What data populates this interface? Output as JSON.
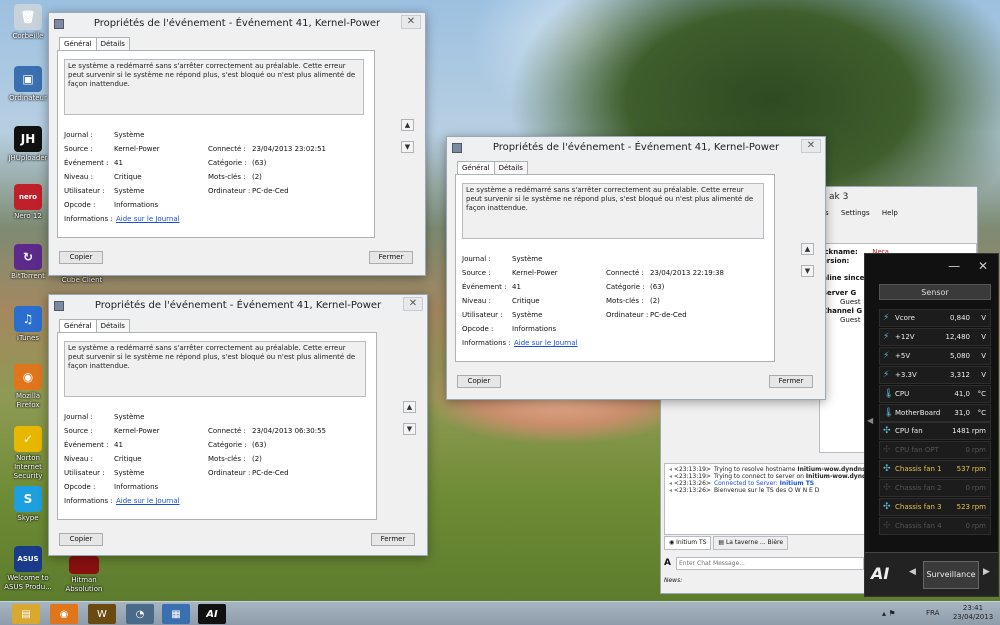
{
  "desktop_icons": [
    {
      "label": "Corbeille",
      "glyph": "🗑",
      "color": "#c8d2dc"
    },
    {
      "label": "Ordinateur",
      "glyph": "▣",
      "color": "#3a6fb0"
    },
    {
      "label": "JHUploader",
      "glyph": "JH",
      "color": "#111111"
    },
    {
      "label": "Nero 12",
      "glyph": "nero",
      "color": "#c0202a"
    },
    {
      "label": "BitTorrent",
      "glyph": "↻",
      "color": "#5b2a8a"
    },
    {
      "label": "iTunes",
      "glyph": "♫",
      "color": "#2a6fd0"
    },
    {
      "label": "Mozilla Firefox",
      "glyph": "◉",
      "color": "#e0751c"
    },
    {
      "label": "Norton Internet Security",
      "glyph": "✓",
      "color": "#e8b800"
    },
    {
      "label": "Skype",
      "glyph": "S",
      "color": "#1ea0e0"
    },
    {
      "label": "Welcome to ASUS Produ...",
      "glyph": "ASUS",
      "color": "#1a3a8a"
    }
  ],
  "extra_icons": [
    {
      "label": "Cube Client"
    },
    {
      "label": "Hitman Absolution"
    }
  ],
  "event_windows": [
    {
      "title": "Propriétés de l'événement - Événement 41, Kernel-Power",
      "tab_general": "Général",
      "tab_details": "Détails",
      "description": "Le système a redémarré sans s'arrêter correctement au préalable. Cette erreur peut survenir si le système ne répond plus, s'est bloqué ou n'est plus alimenté de façon inattendue.",
      "journal_label": "Journal :",
      "journal": "Système",
      "source_label": "Source :",
      "source": "Kernel-Power",
      "event_label": "Événement :",
      "event": "41",
      "level_label": "Niveau :",
      "level": "Critique",
      "user_label": "Utilisateur :",
      "user": "Système",
      "opcode_label": "Opcode :",
      "opcode": "Informations",
      "info_label": "Informations :",
      "info_link": "Aide sur le Journal",
      "logged_label": "Connecté :",
      "logged": "23/04/2013 23:02:51",
      "category_label": "Catégorie :",
      "category": "(63)",
      "keywords_label": "Mots-clés :",
      "keywords": "(2)",
      "computer_label": "Ordinateur :",
      "computer": "PC-de-Ced",
      "copy": "Copier",
      "close": "Fermer"
    },
    {
      "title": "Propriétés de l'événement - Événement 41, Kernel-Power",
      "tab_general": "Général",
      "tab_details": "Détails",
      "description": "Le système a redémarré sans s'arrêter correctement au préalable. Cette erreur peut survenir si le système ne répond plus, s'est bloqué ou n'est plus alimenté de façon inattendue.",
      "journal_label": "Journal :",
      "journal": "Système",
      "source_label": "Source :",
      "source": "Kernel-Power",
      "event_label": "Événement :",
      "event": "41",
      "level_label": "Niveau :",
      "level": "Critique",
      "user_label": "Utilisateur :",
      "user": "Système",
      "opcode_label": "Opcode :",
      "opcode": "Informations",
      "info_label": "Informations :",
      "info_link": "Aide sur le Journal",
      "logged_label": "Connecté :",
      "logged": "23/04/2013 06:30:55",
      "category_label": "Catégorie :",
      "category": "(63)",
      "keywords_label": "Mots-clés :",
      "keywords": "(2)",
      "computer_label": "Ordinateur :",
      "computer": "PC-de-Ced",
      "copy": "Copier",
      "close": "Fermer"
    },
    {
      "title": "Propriétés de l'événement - Événement 41, Kernel-Power",
      "tab_general": "Général",
      "tab_details": "Détails",
      "description": "Le système a redémarré sans s'arrêter correctement au préalable. Cette erreur peut survenir si le système ne répond plus, s'est bloqué ou n'est plus alimenté de façon inattendue.",
      "journal_label": "Journal :",
      "journal": "Système",
      "source_label": "Source :",
      "source": "Kernel-Power",
      "event_label": "Événement :",
      "event": "41",
      "level_label": "Niveau :",
      "level": "Critique",
      "user_label": "Utilisateur :",
      "user": "Système",
      "opcode_label": "Opcode :",
      "opcode": "Informations",
      "info_label": "Informations :",
      "info_link": "Aide sur le Journal",
      "logged_label": "Connecté :",
      "logged": "23/04/2013 22:19:38",
      "category_label": "Catégorie :",
      "category": "(63)",
      "keywords_label": "Mots-clés :",
      "keywords": "(2)",
      "computer_label": "Ordinateur :",
      "computer": "PC-de-Ced",
      "copy": "Copier",
      "close": "Fermer"
    }
  ],
  "teamspeak": {
    "title": "ak 3",
    "menu": [
      "ks",
      "Settings",
      "Help"
    ],
    "info_nickname": "ickname:",
    "info_version": "ersion:",
    "nickname_value": "Nera",
    "online_since": "nline since",
    "server_group": "Server G",
    "server_group_value": "Guest",
    "channel_group": "Channel G",
    "channel_group_value": "Guest",
    "chat_lines": [
      {
        "time": "<23:13:19>",
        "text": "Trying to resolve hostname ",
        "bold": "Initium-wow.dyndns"
      },
      {
        "time": "<23:13:19>",
        "text": "Trying to connect to server on ",
        "bold": "Initium-wow.dynd"
      },
      {
        "time": "<23:13:26>",
        "text": "Connected to Server: ",
        "bold": "Initium TS",
        "blue": true
      },
      {
        "time": "<23:13:26>",
        "text": "Bienvenue sur le TS des O W N E D",
        "bold": ""
      }
    ],
    "tab1": "Initium TS",
    "tab2": "La taverne ... Bière",
    "chat_placeholder": "Enter Chat Message...",
    "news": "News:"
  },
  "ai_suite": {
    "header": "Sensor",
    "rows": [
      {
        "name": "Vcore",
        "value": "0,840",
        "unit": "V",
        "kind": "volt"
      },
      {
        "name": "+12V",
        "value": "12,480",
        "unit": "V",
        "kind": "volt"
      },
      {
        "name": "+5V",
        "value": "5,080",
        "unit": "V",
        "kind": "volt"
      },
      {
        "name": "+3.3V",
        "value": "3,312",
        "unit": "V",
        "kind": "volt"
      },
      {
        "name": "CPU",
        "value": "41,0",
        "unit": "°C",
        "kind": "temp"
      },
      {
        "name": "MotherBoard",
        "value": "31,0",
        "unit": "°C",
        "kind": "temp"
      },
      {
        "name": "CPU fan",
        "value": "1481",
        "unit": "rpm",
        "kind": "fan"
      },
      {
        "name": "CPU fan OPT",
        "value": "0",
        "unit": "rpm",
        "kind": "dim"
      },
      {
        "name": "Chassis fan 1",
        "value": "537",
        "unit": "rpm",
        "kind": "yellow"
      },
      {
        "name": "Chassis fan 2",
        "value": "0",
        "unit": "rpm",
        "kind": "dim"
      },
      {
        "name": "Chassis fan 3",
        "value": "523",
        "unit": "rpm",
        "kind": "yellow"
      },
      {
        "name": "Chassis fan 4",
        "value": "0",
        "unit": "rpm",
        "kind": "dim"
      }
    ],
    "bottom_label": "Surveillance",
    "minimize": "—",
    "close": "✕"
  },
  "taskbar": {
    "lang": "FRA",
    "time": "23:41",
    "date": "23/04/2013"
  }
}
